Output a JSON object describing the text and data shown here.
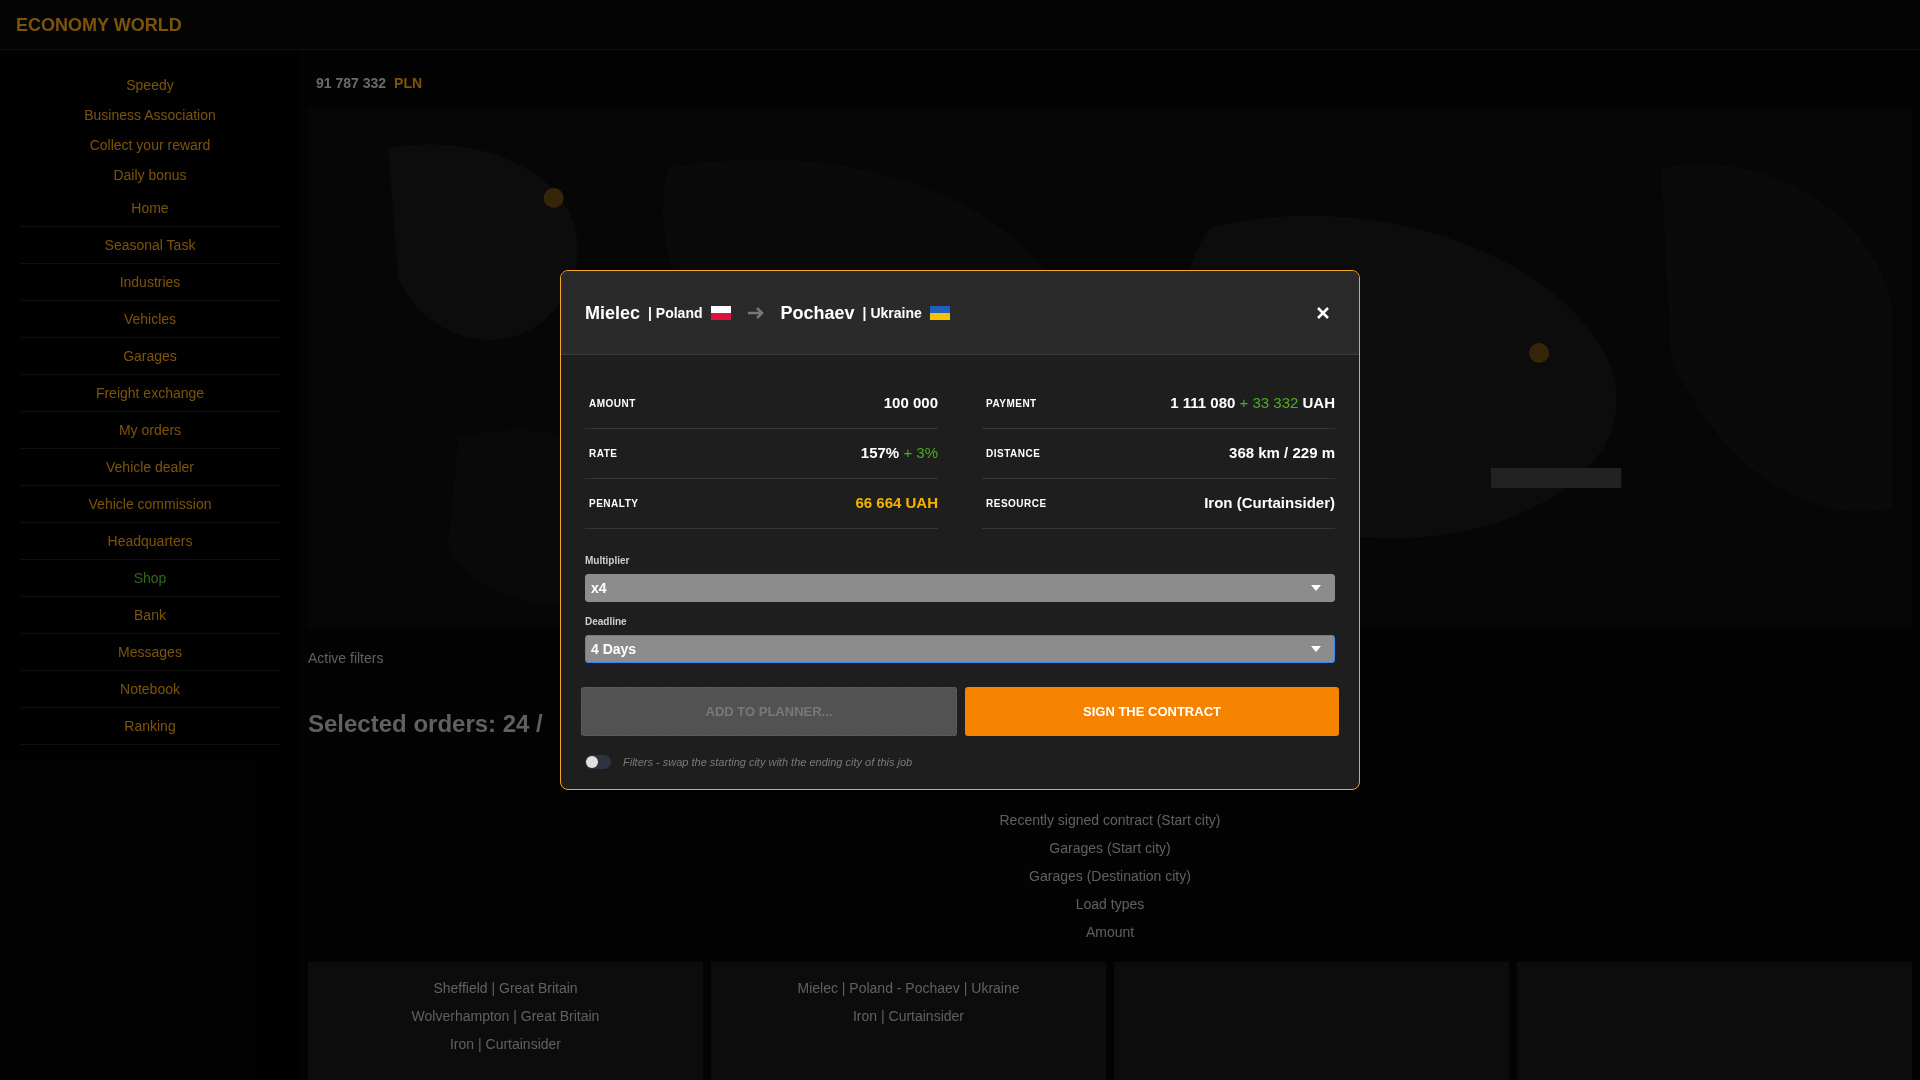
{
  "app_title": "ECONOMY WORLD",
  "sidebar": {
    "items": [
      {
        "label": "Speedy",
        "kind": "header"
      },
      {
        "label": "Business Association",
        "kind": "header"
      },
      {
        "label": "Collect your reward",
        "kind": "header"
      },
      {
        "label": "Daily bonus",
        "kind": "header"
      },
      {
        "label": "Home",
        "kind": "link"
      },
      {
        "label": "Seasonal Task",
        "kind": "link"
      },
      {
        "label": "Industries",
        "kind": "link"
      },
      {
        "label": "Vehicles",
        "kind": "link"
      },
      {
        "label": "Garages",
        "kind": "link"
      },
      {
        "label": "Freight exchange",
        "kind": "link"
      },
      {
        "label": "My orders",
        "kind": "link"
      },
      {
        "label": "Vehicle dealer",
        "kind": "link"
      },
      {
        "label": "Vehicle commission",
        "kind": "link"
      },
      {
        "label": "Headquarters",
        "kind": "link"
      },
      {
        "label": "Shop",
        "kind": "special"
      },
      {
        "label": "Bank",
        "kind": "link"
      },
      {
        "label": "Messages",
        "kind": "link"
      },
      {
        "label": "Notebook",
        "kind": "link"
      },
      {
        "label": "Ranking",
        "kind": "link"
      }
    ]
  },
  "main": {
    "balance": "91 787 332",
    "currency": "PLN",
    "active_filters": "Active filters",
    "selected_orders": "Selected orders: 24 /",
    "filters": [
      {
        "label": "Recently signed contract (Start city)"
      },
      {
        "label": "Garages (Start city)"
      },
      {
        "label": "Garages (Destination city)"
      },
      {
        "label": "Load types"
      },
      {
        "label": "Amount"
      }
    ],
    "cards": [
      {
        "lines": [
          "Sheffield | Great Britain",
          "Wolverhampton | Great Britain",
          "Iron | Curtainsider"
        ]
      },
      {
        "lines": [
          "Mielec | Poland - Pochaev | Ukraine",
          "Iron | Curtainsider"
        ]
      }
    ]
  },
  "modal": {
    "from": {
      "city": "Mielec",
      "separator": "|",
      "country": "Poland"
    },
    "to": {
      "city": "Pochaev",
      "separator": "|",
      "country": "Ukraine"
    },
    "stats": [
      {
        "label": "AMOUNT",
        "value": "100 000",
        "kind": "plain"
      },
      {
        "label": "PAYMENT",
        "value": "1 111 080",
        "bonus": "+ 33 332",
        "suffix": "UAH",
        "kind": "plain"
      },
      {
        "label": "RATE",
        "value": "157%",
        "bonus": "+ 3%",
        "kind": "plain"
      },
      {
        "label": "DISTANCE",
        "value": "368 km / 229 m",
        "kind": "plain"
      },
      {
        "label": "PENALTY",
        "value": "66 664 UAH",
        "kind": "warning"
      },
      {
        "label": "RESOURCE",
        "value": "Iron (Curtainsider)",
        "kind": "plain"
      }
    ],
    "fields": [
      {
        "label": "Multiplier",
        "value": "x4",
        "focused": false
      },
      {
        "label": "Deadline",
        "value": "4 Days",
        "focused": true
      }
    ],
    "buttons": [
      {
        "label": "ADD TO PLANNER...",
        "kind": "secondary",
        "disabled": true
      },
      {
        "label": "SIGN THE CONTRACT",
        "kind": "primary",
        "disabled": false
      }
    ],
    "toggle": {
      "label": "Filters - swap the starting city with the ending city of this job",
      "on": false
    }
  }
}
